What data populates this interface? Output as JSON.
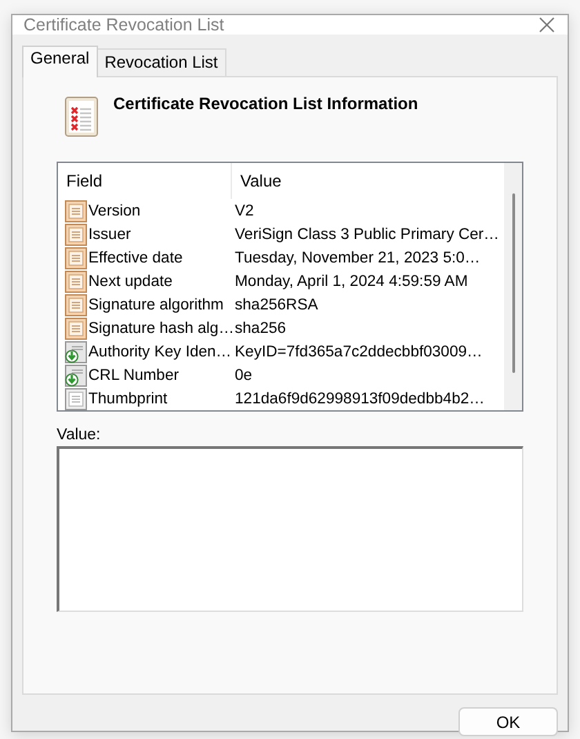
{
  "window": {
    "title": "Certificate Revocation List"
  },
  "tabs": [
    {
      "label": "General",
      "selected": true
    },
    {
      "label": "Revocation List",
      "selected": false
    }
  ],
  "heading": "Certificate Revocation List Information",
  "table": {
    "columns": [
      "Field",
      "Value"
    ],
    "rows": [
      {
        "kind": "property",
        "field": "Version",
        "value": "V2"
      },
      {
        "kind": "property",
        "field": "Issuer",
        "value": "VeriSign Class 3 Public Primary Cer…"
      },
      {
        "kind": "property",
        "field": "Effective date",
        "value": "Tuesday, November 21, 2023 5:0…"
      },
      {
        "kind": "property",
        "field": "Next update",
        "value": "Monday, April 1, 2024 4:59:59 AM"
      },
      {
        "kind": "property",
        "field": "Signature algorithm",
        "value": "sha256RSA"
      },
      {
        "kind": "property",
        "field": "Signature hash alg…",
        "value": "sha256"
      },
      {
        "kind": "extension",
        "field": "Authority Key Iden…",
        "value": "KeyID=7fd365a7c2ddecbbf03009…"
      },
      {
        "kind": "extension",
        "field": "CRL Number",
        "value": "0e"
      },
      {
        "kind": "plain",
        "field": "Thumbprint",
        "value": "121da6f9d62998913f09dedbb4b2…"
      }
    ]
  },
  "value_label": "Value:",
  "buttons": [
    "OK"
  ]
}
